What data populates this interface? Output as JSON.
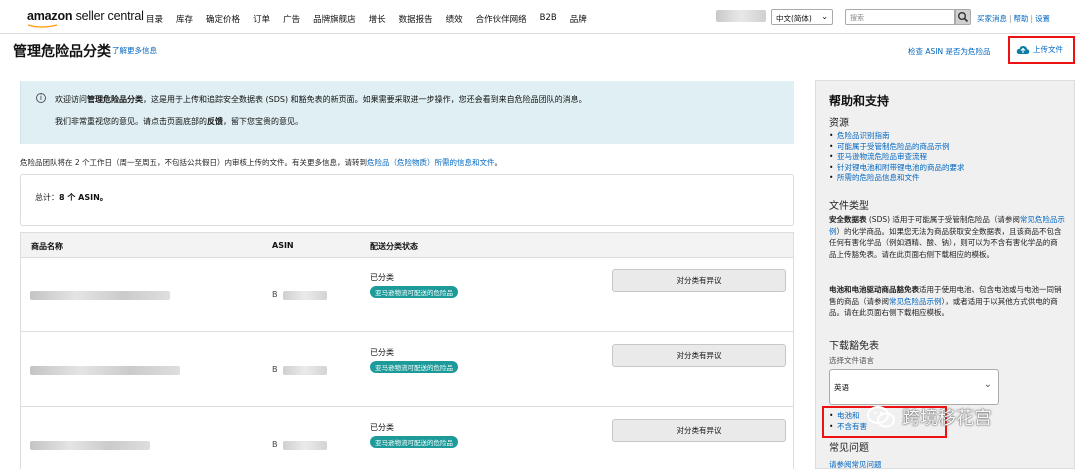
{
  "topnav": {
    "logo_bold": "amazon",
    "logo_rest": " seller central",
    "menu": [
      "目录",
      "库存",
      "确定价格",
      "订单",
      "广告",
      "品牌旗舰店",
      "增长",
      "数据报告",
      "绩效",
      "合作伙伴网络",
      "B2B",
      "品牌"
    ],
    "language": "中文(简体)",
    "search_placeholder": "搜索",
    "links": [
      "买家消息",
      "帮助",
      "设置"
    ]
  },
  "header": {
    "title": "管理危险品分类",
    "learn_more": "了解更多信息",
    "check_asin": "检查 ASIN 是否为危险品",
    "upload": "上传文件"
  },
  "banner": {
    "line1_pre": "欢迎访问",
    "line1_bold": "管理危险品分类",
    "line1_post": "，这是用于上传和追踪安全数据表 (SDS) 和豁免表的新页面。如果需要采取进一步操作，您还会看到来自危险品团队的消息。",
    "line2_pre": "我们非常重视您的意见。请点击页面底部的",
    "line2_bold": "反馈",
    "line2_post": "，留下您宝贵的意见。"
  },
  "note": {
    "pre": "危险品团队将在 2 个工作日（周一至周五，不包括公共假日）内审核上传的文件。有关更多信息，请转到",
    "link": "危险品（危险物质）所需的信息和文件",
    "post": "。"
  },
  "total": {
    "label": "总计：",
    "value": "8 个 ASIN。"
  },
  "table": {
    "columns": [
      "商品名称",
      "ASIN",
      "配送分类状态"
    ],
    "rows": [
      {
        "asin_prefix": "B",
        "status": "已分类",
        "badge": "亚马逊物流可配送的危险品",
        "button": "对分类有异议"
      },
      {
        "asin_prefix": "B",
        "status": "已分类",
        "badge": "亚马逊物流可配送的危险品",
        "button": "对分类有异议"
      },
      {
        "asin_prefix": "B",
        "status": "已分类",
        "badge": "亚马逊物流可配送的危险品",
        "button": "对分类有异议"
      }
    ]
  },
  "sidebar": {
    "title": "帮助和支持",
    "resources_heading": "资源",
    "resources": [
      "危险品识别指南",
      "可能属于受管制危险品的商品示例",
      "亚马逊物流危险品审查流程",
      "针对锂电池和附带锂电池的商品的要求",
      "所需的危险品信息和文件"
    ],
    "filetypes_heading": "文件类型",
    "sds_bold": "安全数据表",
    "sds_text": " (SDS) 适用于可能属于受管制危险品（请参阅",
    "sds_link": "常见危险品示例",
    "sds_text2": "）的化学商品。如果您无法为商品获取安全数据表，且该商品不包含任何有害化学品（例如酒精、酸、钠），则可以为不含有害化学品的商品上传豁免表。请在此页面右侧下载相应的模板。",
    "battery_bold": "电池和电池驱动商品豁免表",
    "battery_text": "适用于使用电池、包含电池或与电池一同销售的商品（请参阅",
    "battery_link": "常见危险品示例",
    "battery_text2": "），或者适用于以其他方式供电的商品。请在此页面右侧下载相应模板。",
    "download_heading": "下载豁免表",
    "choose_lang": "选择文件语言",
    "lang_value": "英语",
    "download_links": [
      "电池和",
      "不含有害"
    ],
    "faq_heading": "常见问题",
    "faq_link": "请参阅常见问题"
  },
  "watermark": {
    "text": "跨境移花宫"
  },
  "colors": {
    "accent_link": "#0066c0",
    "badge_teal": "#1d9a9a",
    "banner_bg": "#dfeff3",
    "highlight_red": "#e11111"
  }
}
